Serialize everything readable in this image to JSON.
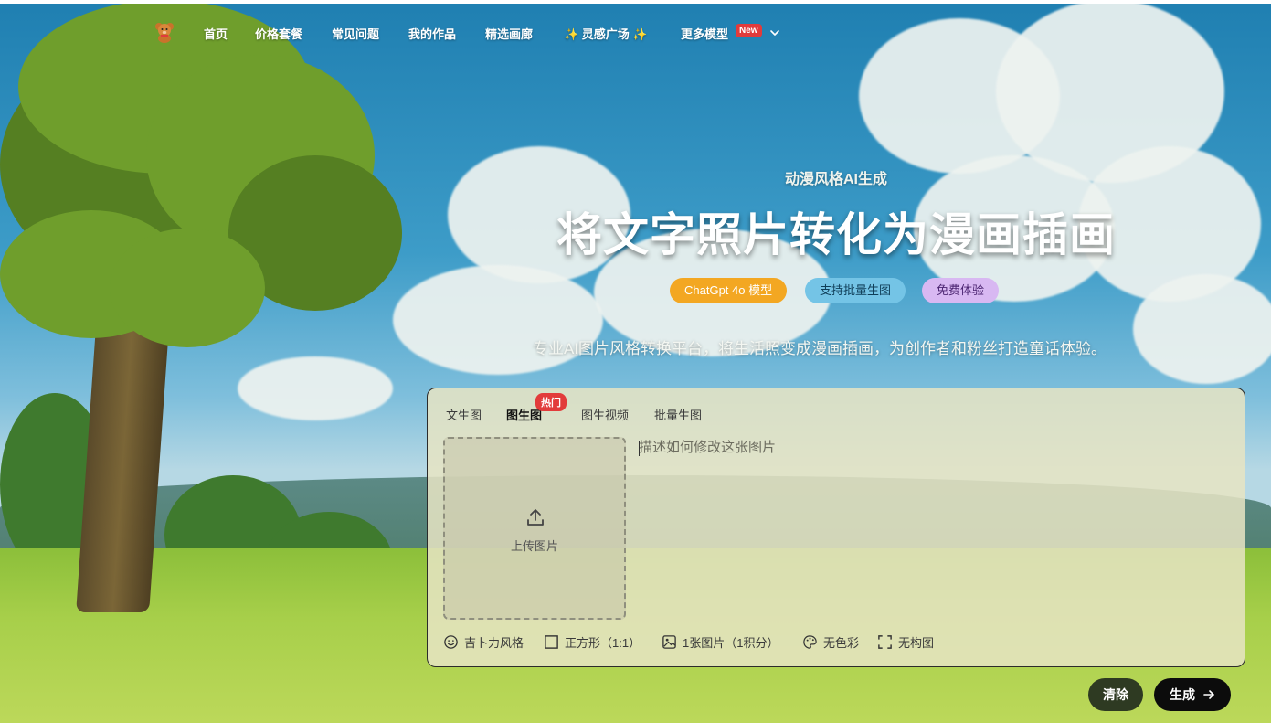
{
  "nav": {
    "items": [
      "首页",
      "价格套餐",
      "常见问题",
      "我的作品",
      "精选画廊",
      "✨ 灵感广场 ✨",
      "更多模型"
    ],
    "new_badge": "New",
    "logo_icon": "teddy-bear-icon"
  },
  "hero": {
    "kicker": "动漫风格AI生成",
    "headline": "将文字照片转化为漫画插画",
    "pills": [
      "ChatGpt 4o 模型",
      "支持批量生图",
      "免费体验"
    ],
    "description": "专业AI图片风格转换平台，将生活照变成漫画插画，为创作者和粉丝打造童话体验。"
  },
  "panel": {
    "tabs": [
      "文生图",
      "图生图",
      "图生视频",
      "批量生图"
    ],
    "active_tab": "图生图",
    "hot_badge": "热门",
    "upload_label": "上传图片",
    "prompt_placeholder": "描述如何修改这张图片",
    "options": [
      "吉卜力风格",
      "正方形（1:1）",
      "1张图片（1积分）",
      "无色彩",
      "无构图"
    ]
  },
  "buttons": {
    "clear": "清除",
    "generate": "生成"
  },
  "colors": {
    "accent_orange": "#f3a722",
    "accent_blue": "#74c4e6",
    "accent_purple": "#d8b8f2",
    "badge_red": "#e23b3b"
  }
}
